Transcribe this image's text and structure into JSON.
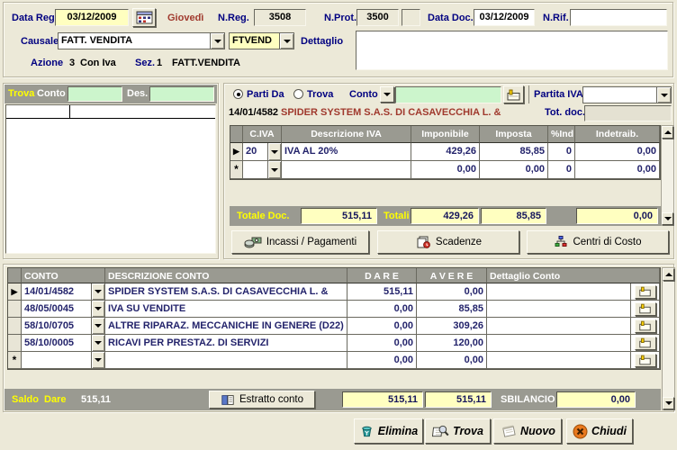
{
  "header": {
    "data_reg_label": "Data Reg.",
    "data_reg_value": "03/12/2009",
    "weekday": "Giovedì",
    "n_reg_label": "N.Reg.",
    "n_reg_value": "3508",
    "n_prot_label": "N.Prot.",
    "n_prot_value": "3500",
    "data_doc_label": "Data Doc.",
    "data_doc_value": "03/12/2009",
    "n_rif_label": "N.Rif.",
    "n_rif_value": "",
    "causale_label": "Causale",
    "causale_value": "FATT. VENDITA",
    "causale_code": "FTVEND",
    "dettaglio_label": "Dettaglio",
    "dettaglio_value": "",
    "azione_label": "Azione",
    "azione_value": "3",
    "azione_mode": "Con Iva",
    "sez_label": "Sez.",
    "sez_value": "1",
    "sez_desc": "FATT.VENDITA"
  },
  "search_panel": {
    "trova_label": "Trova",
    "conto_label": "Conto",
    "conto_value": "",
    "des_label": "Des.",
    "des_value": ""
  },
  "account_panel": {
    "radio_parti_da": "Parti Da",
    "radio_trova": "Trova",
    "conto_label": "Conto",
    "conto_value": "",
    "partita_iva_label": "Partita IVA",
    "partita_iva_value": "",
    "account_code": "14/01/4582",
    "account_name": "SPIDER SYSTEM S.A.S. DI CASAVECCHIA L. &",
    "tot_doc_label": "Tot. doc.",
    "tot_doc_value": ""
  },
  "iva_table": {
    "headers": {
      "civa": "C.IVA",
      "descrizione": "Descrizione IVA",
      "imponibile": "Imponibile",
      "imposta": "Imposta",
      "ind": "%Ind",
      "indetraib": "Indetraib."
    },
    "rows": [
      {
        "marker": "▶",
        "civa": "20",
        "descrizione": "IVA AL 20%",
        "imponibile": "429,26",
        "imposta": "85,85",
        "ind": "0",
        "indetraib": "0,00"
      },
      {
        "marker": "*",
        "civa": "",
        "descrizione": "",
        "imponibile": "0,00",
        "imposta": "0,00",
        "ind": "0",
        "indetraib": "0,00"
      }
    ],
    "totale_doc_label": "Totale Doc.",
    "totale_doc_value": "515,11",
    "totali_label": "Totali",
    "totale_imponibile": "429,26",
    "totale_imposta": "85,85",
    "totale_indetraib": "0,00"
  },
  "mid_buttons": {
    "incassi": "Incassi / Pagamenti",
    "scadenze": "Scadenze",
    "centri_costo": "Centri di Costo"
  },
  "conto_table": {
    "headers": {
      "conto": "CONTO",
      "descrizione": "DESCRIZIONE CONTO",
      "dare": "D A R E",
      "avere": "A V E R E",
      "dettaglio": "Dettaglio Conto"
    },
    "rows": [
      {
        "marker": "▶",
        "conto": "14/01/4582",
        "descrizione": "SPIDER SYSTEM S.A.S. DI CASAVECCHIA L. &",
        "dare": "515,11",
        "avere": "0,00",
        "dettaglio": ""
      },
      {
        "marker": "",
        "conto": "48/05/0045",
        "descrizione": "IVA SU VENDITE",
        "dare": "0,00",
        "avere": "85,85",
        "dettaglio": ""
      },
      {
        "marker": "",
        "conto": "58/10/0705",
        "descrizione": "ALTRE RIPARAZ. MECCANICHE IN GENERE (D22)",
        "dare": "0,00",
        "avere": "309,26",
        "dettaglio": ""
      },
      {
        "marker": "",
        "conto": "58/10/0005",
        "descrizione": "RICAVI PER PRESTAZ. DI SERVIZI",
        "dare": "0,00",
        "avere": "120,00",
        "dettaglio": ""
      },
      {
        "marker": "*",
        "conto": "",
        "descrizione": "",
        "dare": "0,00",
        "avere": "0,00",
        "dettaglio": ""
      }
    ]
  },
  "footer": {
    "saldo_label": "Saldo  Dare",
    "saldo_value": "515,11",
    "estratto_label": "Estratto conto",
    "totale_dare": "515,11",
    "totale_avere": "515,11",
    "sbilancio_label": "SBILANCIO",
    "sbilancio_value": "0,00"
  },
  "bottom_buttons": {
    "elimina": "Elimina",
    "trova": "Trova",
    "nuovo": "Nuovo",
    "chiudi": "Chiudi"
  },
  "colors": {
    "background": "#ECE9D8",
    "bar_gray": "#9A9A91",
    "field_yellow": "#FFFFC0",
    "field_green": "#CCF5CC",
    "label_navy": "#000080",
    "maroon_text": "#A0392D",
    "bar_yellow_text": "#FFFF00"
  }
}
